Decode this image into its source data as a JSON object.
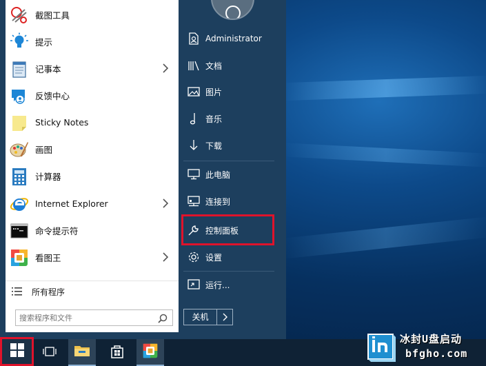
{
  "start_menu": {
    "programs": [
      {
        "label": "截图工具",
        "icon": "snipping-tool-icon",
        "has_submenu": false
      },
      {
        "label": "提示",
        "icon": "tips-bulb-icon",
        "has_submenu": false
      },
      {
        "label": "记事本",
        "icon": "notepad-icon",
        "has_submenu": true
      },
      {
        "label": "反馈中心",
        "icon": "feedback-hub-icon",
        "has_submenu": false
      },
      {
        "label": "Sticky Notes",
        "icon": "sticky-notes-icon",
        "has_submenu": false
      },
      {
        "label": "画图",
        "icon": "paint-palette-icon",
        "has_submenu": false
      },
      {
        "label": "计算器",
        "icon": "calculator-icon",
        "has_submenu": false
      },
      {
        "label": "Internet Explorer",
        "icon": "internet-explorer-icon",
        "has_submenu": true
      },
      {
        "label": "命令提示符",
        "icon": "command-prompt-icon",
        "has_submenu": false
      },
      {
        "label": "看图王",
        "icon": "picture-viewer-icon",
        "has_submenu": true
      }
    ],
    "all_programs_label": "所有程序",
    "search_placeholder": "搜索程序和文件",
    "right_items": [
      {
        "label": "Administrator",
        "icon": "user-account-icon"
      },
      {
        "label": "文档",
        "icon": "documents-icon"
      },
      {
        "label": "图片",
        "icon": "pictures-icon"
      },
      {
        "label": "音乐",
        "icon": "music-icon"
      },
      {
        "label": "下载",
        "icon": "download-icon"
      },
      {
        "label": "此电脑",
        "icon": "this-pc-icon"
      },
      {
        "label": "连接到",
        "icon": "connect-to-icon"
      },
      {
        "label": "控制面板",
        "icon": "control-panel-wrench-icon"
      },
      {
        "label": "设置",
        "icon": "settings-gear-icon"
      },
      {
        "label": "运行...",
        "icon": "run-icon"
      }
    ],
    "highlighted_item": "控制面板",
    "power_label": "关机"
  },
  "taskbar": {
    "items": [
      "start-button",
      "task-view",
      "file-explorer",
      "store",
      "picture-viewer"
    ]
  },
  "watermark": {
    "line1": "冰封U盘启动",
    "line2": "bfgho.com"
  },
  "colors": {
    "highlight_red": "#e0132b",
    "menu_dark": "#1d3f5e",
    "taskbar": "#0f2235"
  }
}
